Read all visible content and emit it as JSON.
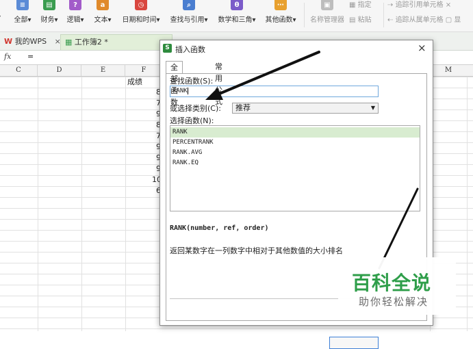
{
  "ribbon": {
    "buttons": [
      {
        "label": "全部",
        "icon": "list-icon",
        "color": "#5b8bd6"
      },
      {
        "label": "财务",
        "icon": "finance-icon",
        "color": "#3a9c4f"
      },
      {
        "label": "逻辑",
        "icon": "question-icon",
        "color": "#a25bc9",
        "glyph": "?"
      },
      {
        "label": "文本",
        "icon": "text-a-icon",
        "color": "#e08a2c",
        "glyph": "a"
      },
      {
        "label": "日期和时间",
        "icon": "clock-icon",
        "color": "#d9473f"
      },
      {
        "label": "查找与引用",
        "icon": "search-icon",
        "color": "#4a7ed0"
      },
      {
        "label": "数学和三角",
        "icon": "theta-icon",
        "color": "#7b5bc9",
        "glyph": "θ"
      },
      {
        "label": "其他函数",
        "icon": "more-icon",
        "color": "#e8a02e"
      }
    ],
    "name_manager": "名称管理器",
    "paste": "粘贴",
    "specify": "指定",
    "trace_precedents": "追踪引用单元格",
    "trace_dependents": "追踪从属单元格",
    "show": "显"
  },
  "tabs": {
    "wps": "我的WPS",
    "workbook": "工作簿2 *",
    "close_glyph": "×"
  },
  "formula_bar": {
    "fx": "fx",
    "eq": "="
  },
  "sheet": {
    "columns": [
      "C",
      "D",
      "E",
      "F",
      "M"
    ],
    "header_cell": "成绩",
    "values": [
      "8",
      "7",
      "9",
      "8",
      "7",
      "9",
      "9",
      "9",
      "10",
      "6"
    ]
  },
  "dialog": {
    "title": "插入函数",
    "close_glyph": "×",
    "tab_all": "全部函数",
    "tab_common": "常用公式",
    "search_label": "查找函数(S):",
    "search_value": "RANK",
    "category_label": "或选择类别(C):",
    "category_value": "推荐",
    "select_label": "选择函数(N):",
    "functions": [
      "RANK",
      "PERCENTRANK",
      "RANK.AVG",
      "RANK.EQ"
    ],
    "signature": "RANK(number, ref, order)",
    "description": "返回某数字在一列数字中相对于其他数值的大小排名"
  },
  "watermark": {
    "main": "百科全说",
    "sub": "助你轻松解决"
  }
}
